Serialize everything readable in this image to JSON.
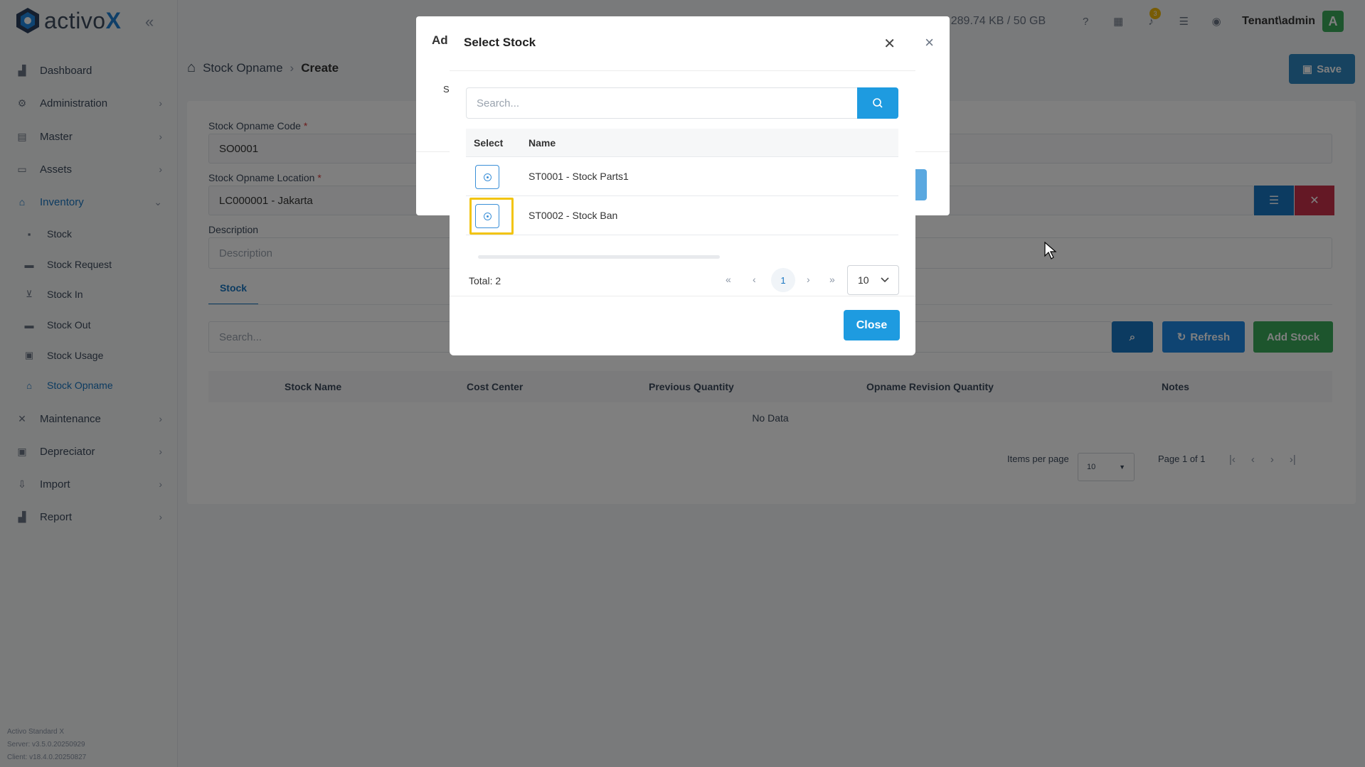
{
  "app": {
    "logo_prefix": "activo",
    "logo_suffix": "X"
  },
  "sidebar": {
    "items": [
      {
        "label": "Dashboard",
        "icon": "chart-icon"
      },
      {
        "label": "Administration",
        "icon": "gears-icon"
      },
      {
        "label": "Master",
        "icon": "database-icon"
      },
      {
        "label": "Assets",
        "icon": "laptop-icon"
      },
      {
        "label": "Inventory",
        "icon": "warehouse-icon"
      },
      {
        "label": "Maintenance",
        "icon": "tools-icon"
      },
      {
        "label": "Depreciator",
        "icon": "clipboard-icon"
      },
      {
        "label": "Import",
        "icon": "import-icon"
      },
      {
        "label": "Report",
        "icon": "report-icon"
      }
    ],
    "sub_items": [
      {
        "label": "Stock"
      },
      {
        "label": "Stock Request"
      },
      {
        "label": "Stock In"
      },
      {
        "label": "Stock Out"
      },
      {
        "label": "Stock Usage"
      },
      {
        "label": "Stock Opname"
      }
    ],
    "version_lines": [
      "Activo Standard X",
      "Server: v3.5.0.20250929",
      "Client: v18.4.0.20250827"
    ]
  },
  "header": {
    "storage": "e: 289.74 KB / 50 GB",
    "notification_count": "3",
    "user": "Tenant\\admin",
    "avatar_letter": "A"
  },
  "breadcrumb": {
    "section": "Stock Opname",
    "page": "Create"
  },
  "toolbar": {
    "save_label": "Save"
  },
  "form": {
    "code_label": "Stock Opname Code",
    "code_value": "SO0001",
    "location_label": "Stock Opname Location",
    "location_value": "LC000001 - Jakarta",
    "description_label": "Description",
    "description_placeholder": "Description",
    "required_mark": "*"
  },
  "tabs": {
    "stock": "Stock"
  },
  "table": {
    "search_placeholder": "Search...",
    "refresh_label": "Refresh",
    "add_label": "Add Stock",
    "columns": [
      "Stock Name",
      "Cost Center",
      "Previous Quantity",
      "Opname Revision Quantity",
      "Notes"
    ],
    "empty": "No Data",
    "items_per_page_label": "Items per page",
    "items_per_page_value": "10",
    "page_info": "Page 1 of 1"
  },
  "back_dialog": {
    "title": "Ad",
    "field_hint": "S"
  },
  "modal": {
    "title": "Select Stock",
    "search_placeholder": "Search...",
    "columns": [
      "Select",
      "Name"
    ],
    "rows": [
      {
        "name": "ST0001 - Stock Parts1"
      },
      {
        "name": "ST0002 - Stock Ban"
      }
    ],
    "total": "Total: 2",
    "current_page": "1",
    "page_size": "10",
    "close_label": "Close"
  },
  "colors": {
    "primary": "#1e9be0",
    "danger": "#c9304a",
    "success": "#3aaa5a",
    "highlight": "#f2c40f"
  }
}
